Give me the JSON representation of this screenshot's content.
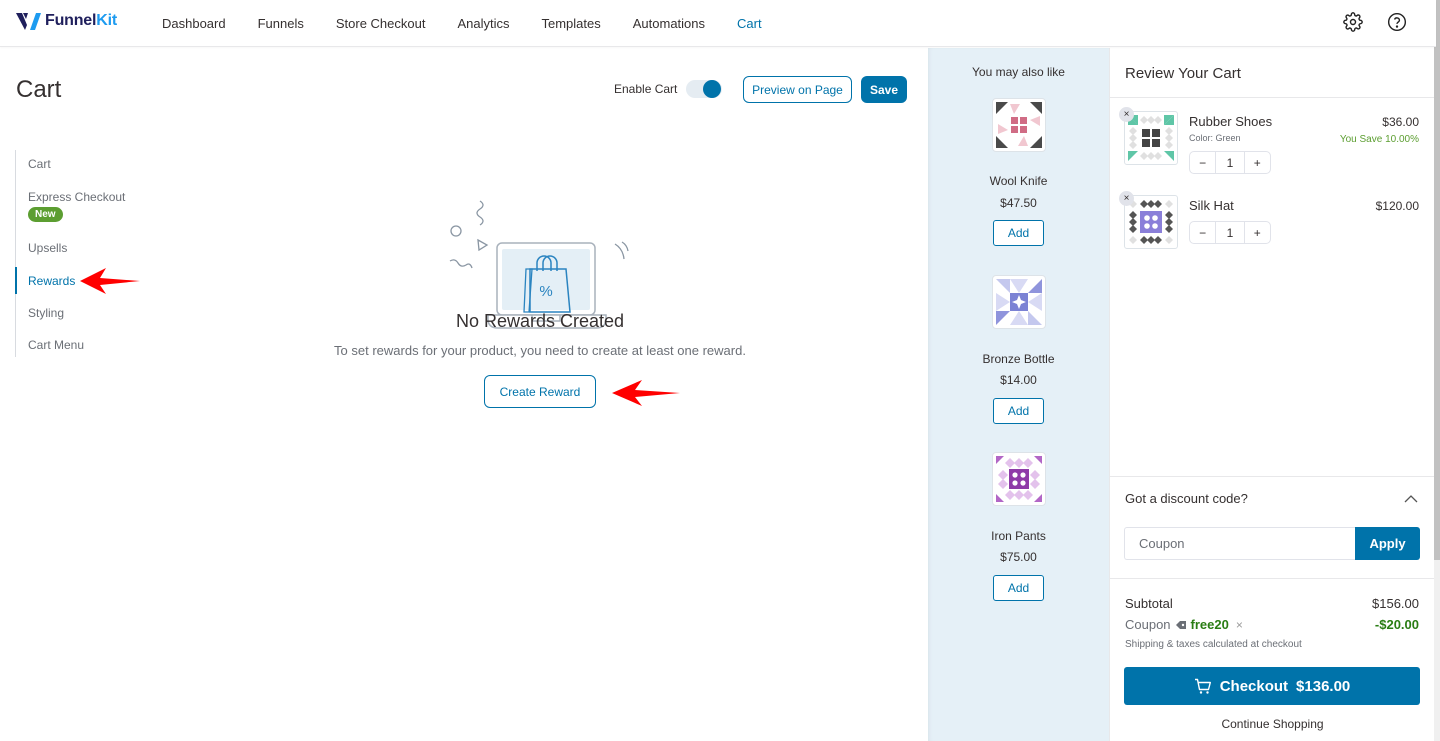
{
  "app": {
    "brand_prefix": "Funnel",
    "brand_suffix": "Kit"
  },
  "nav": {
    "items": [
      {
        "label": "Dashboard",
        "active": false
      },
      {
        "label": "Funnels",
        "active": false
      },
      {
        "label": "Store Checkout",
        "active": false
      },
      {
        "label": "Analytics",
        "active": false
      },
      {
        "label": "Templates",
        "active": false
      },
      {
        "label": "Automations",
        "active": false
      },
      {
        "label": "Cart",
        "active": true
      }
    ],
    "icons": [
      "gear-icon",
      "help-circle-icon"
    ]
  },
  "header": {
    "title": "Cart",
    "enable_cart_label": "Enable Cart",
    "enable_cart_on": true,
    "preview_label": "Preview on Page",
    "save_label": "Save"
  },
  "sidenav": {
    "items": [
      {
        "label": "Cart",
        "active": false
      },
      {
        "label": "Express Checkout",
        "active": false,
        "badge": "New"
      },
      {
        "label": "Upsells",
        "active": false
      },
      {
        "label": "Rewards",
        "active": true
      },
      {
        "label": "Styling",
        "active": false
      },
      {
        "label": "Cart Menu",
        "active": false
      }
    ]
  },
  "empty_state": {
    "title": "No Rewards Created",
    "description": "To set rewards for your product, you need to create at least one reward.",
    "button_label": "Create Reward"
  },
  "upsell": {
    "title": "You may also like",
    "items": [
      {
        "name": "Wool Knife",
        "price": "$47.50",
        "add_label": "Add"
      },
      {
        "name": "Bronze Bottle",
        "price": "$14.00",
        "add_label": "Add"
      },
      {
        "name": "Iron Pants",
        "price": "$75.00",
        "add_label": "Add"
      }
    ]
  },
  "cart": {
    "title": "Review Your Cart",
    "items": [
      {
        "name": "Rubber Shoes",
        "variant": "Color: Green",
        "price": "$36.00",
        "savings": "You Save 10.00%",
        "qty": "1",
        "remove": "×"
      },
      {
        "name": "Silk Hat",
        "variant": "",
        "price": "$120.00",
        "savings": "",
        "qty": "1",
        "remove": "×"
      }
    ],
    "qty_minus": "−",
    "qty_plus": "+",
    "discount": {
      "title": "Got a discount code?",
      "placeholder": "Coupon",
      "value": "",
      "apply_label": "Apply"
    },
    "summary": {
      "subtotal_label": "Subtotal",
      "subtotal_value": "$156.00",
      "coupon_label": "Coupon",
      "coupon_code": "free20",
      "coupon_remove": "×",
      "coupon_value": "-$20.00",
      "shipping_note": "Shipping & taxes calculated at checkout"
    },
    "checkout_label": "Checkout",
    "checkout_total": "$136.00",
    "continue_label": "Continue Shopping"
  },
  "colors": {
    "primary": "#0073aa",
    "success": "#2a7d14",
    "badge_green": "#5c9e31",
    "upsell_bg": "#e5f0f7",
    "annotation_arrow": "#ff0000"
  }
}
